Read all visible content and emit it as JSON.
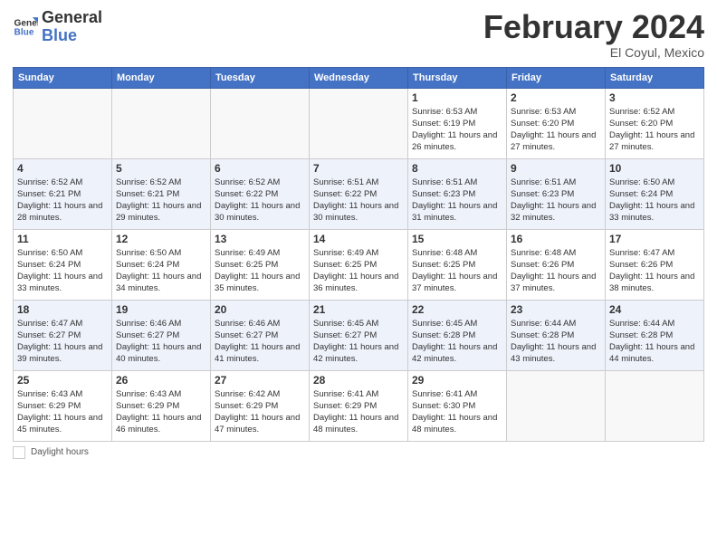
{
  "logo": {
    "line1": "General",
    "line2": "Blue"
  },
  "header": {
    "month": "February 2024",
    "location": "El Coyul, Mexico"
  },
  "days_of_week": [
    "Sunday",
    "Monday",
    "Tuesday",
    "Wednesday",
    "Thursday",
    "Friday",
    "Saturday"
  ],
  "weeks": [
    [
      {
        "day": "",
        "info": ""
      },
      {
        "day": "",
        "info": ""
      },
      {
        "day": "",
        "info": ""
      },
      {
        "day": "",
        "info": ""
      },
      {
        "day": "1",
        "info": "Sunrise: 6:53 AM\nSunset: 6:19 PM\nDaylight: 11 hours and 26 minutes."
      },
      {
        "day": "2",
        "info": "Sunrise: 6:53 AM\nSunset: 6:20 PM\nDaylight: 11 hours and 27 minutes."
      },
      {
        "day": "3",
        "info": "Sunrise: 6:52 AM\nSunset: 6:20 PM\nDaylight: 11 hours and 27 minutes."
      }
    ],
    [
      {
        "day": "4",
        "info": "Sunrise: 6:52 AM\nSunset: 6:21 PM\nDaylight: 11 hours and 28 minutes."
      },
      {
        "day": "5",
        "info": "Sunrise: 6:52 AM\nSunset: 6:21 PM\nDaylight: 11 hours and 29 minutes."
      },
      {
        "day": "6",
        "info": "Sunrise: 6:52 AM\nSunset: 6:22 PM\nDaylight: 11 hours and 30 minutes."
      },
      {
        "day": "7",
        "info": "Sunrise: 6:51 AM\nSunset: 6:22 PM\nDaylight: 11 hours and 30 minutes."
      },
      {
        "day": "8",
        "info": "Sunrise: 6:51 AM\nSunset: 6:23 PM\nDaylight: 11 hours and 31 minutes."
      },
      {
        "day": "9",
        "info": "Sunrise: 6:51 AM\nSunset: 6:23 PM\nDaylight: 11 hours and 32 minutes."
      },
      {
        "day": "10",
        "info": "Sunrise: 6:50 AM\nSunset: 6:24 PM\nDaylight: 11 hours and 33 minutes."
      }
    ],
    [
      {
        "day": "11",
        "info": "Sunrise: 6:50 AM\nSunset: 6:24 PM\nDaylight: 11 hours and 33 minutes."
      },
      {
        "day": "12",
        "info": "Sunrise: 6:50 AM\nSunset: 6:24 PM\nDaylight: 11 hours and 34 minutes."
      },
      {
        "day": "13",
        "info": "Sunrise: 6:49 AM\nSunset: 6:25 PM\nDaylight: 11 hours and 35 minutes."
      },
      {
        "day": "14",
        "info": "Sunrise: 6:49 AM\nSunset: 6:25 PM\nDaylight: 11 hours and 36 minutes."
      },
      {
        "day": "15",
        "info": "Sunrise: 6:48 AM\nSunset: 6:25 PM\nDaylight: 11 hours and 37 minutes."
      },
      {
        "day": "16",
        "info": "Sunrise: 6:48 AM\nSunset: 6:26 PM\nDaylight: 11 hours and 37 minutes."
      },
      {
        "day": "17",
        "info": "Sunrise: 6:47 AM\nSunset: 6:26 PM\nDaylight: 11 hours and 38 minutes."
      }
    ],
    [
      {
        "day": "18",
        "info": "Sunrise: 6:47 AM\nSunset: 6:27 PM\nDaylight: 11 hours and 39 minutes."
      },
      {
        "day": "19",
        "info": "Sunrise: 6:46 AM\nSunset: 6:27 PM\nDaylight: 11 hours and 40 minutes."
      },
      {
        "day": "20",
        "info": "Sunrise: 6:46 AM\nSunset: 6:27 PM\nDaylight: 11 hours and 41 minutes."
      },
      {
        "day": "21",
        "info": "Sunrise: 6:45 AM\nSunset: 6:27 PM\nDaylight: 11 hours and 42 minutes."
      },
      {
        "day": "22",
        "info": "Sunrise: 6:45 AM\nSunset: 6:28 PM\nDaylight: 11 hours and 42 minutes."
      },
      {
        "day": "23",
        "info": "Sunrise: 6:44 AM\nSunset: 6:28 PM\nDaylight: 11 hours and 43 minutes."
      },
      {
        "day": "24",
        "info": "Sunrise: 6:44 AM\nSunset: 6:28 PM\nDaylight: 11 hours and 44 minutes."
      }
    ],
    [
      {
        "day": "25",
        "info": "Sunrise: 6:43 AM\nSunset: 6:29 PM\nDaylight: 11 hours and 45 minutes."
      },
      {
        "day": "26",
        "info": "Sunrise: 6:43 AM\nSunset: 6:29 PM\nDaylight: 11 hours and 46 minutes."
      },
      {
        "day": "27",
        "info": "Sunrise: 6:42 AM\nSunset: 6:29 PM\nDaylight: 11 hours and 47 minutes."
      },
      {
        "day": "28",
        "info": "Sunrise: 6:41 AM\nSunset: 6:29 PM\nDaylight: 11 hours and 48 minutes."
      },
      {
        "day": "29",
        "info": "Sunrise: 6:41 AM\nSunset: 6:30 PM\nDaylight: 11 hours and 48 minutes."
      },
      {
        "day": "",
        "info": ""
      },
      {
        "day": "",
        "info": ""
      }
    ]
  ],
  "legend": {
    "label": "Daylight hours"
  }
}
